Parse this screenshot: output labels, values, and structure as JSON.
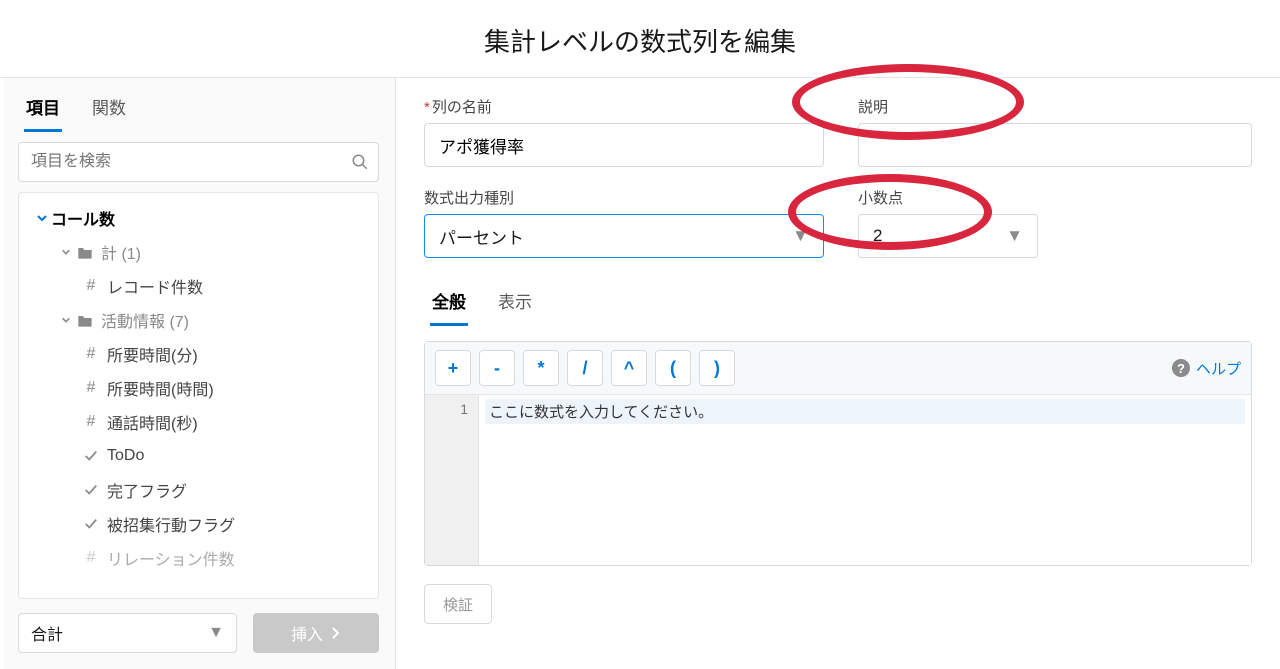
{
  "title": "集計レベルの数式列を編集",
  "sidebar": {
    "tabs": {
      "fields": "項目",
      "functions": "関数"
    },
    "search_placeholder": "項目を検索",
    "tree": {
      "root": "コール数",
      "group1": "計 (1)",
      "record_count": "レコード件数",
      "group2": "活動情報 (7)",
      "items2": [
        "所要時間(分)",
        "所要時間(時間)",
        "通話時間(秒)",
        "ToDo",
        "完了フラグ",
        "被招集行動フラグ",
        "リレーション件数"
      ]
    },
    "agg_select": "合計",
    "insert_btn": "挿入"
  },
  "form": {
    "name_label": "列の名前",
    "name_value": "アポ獲得率",
    "desc_label": "説明",
    "output_type_label": "数式出力種別",
    "output_type_value": "パーセント",
    "decimal_label": "小数点",
    "decimal_value": "2"
  },
  "inner_tabs": {
    "general": "全般",
    "display": "表示"
  },
  "editor": {
    "operators": [
      "+",
      "-",
      "*",
      "/",
      "^",
      "(",
      ")"
    ],
    "help": "ヘルプ",
    "placeholder": "ここに数式を入力してください。",
    "line_no": "1"
  },
  "validate_btn": "検証"
}
